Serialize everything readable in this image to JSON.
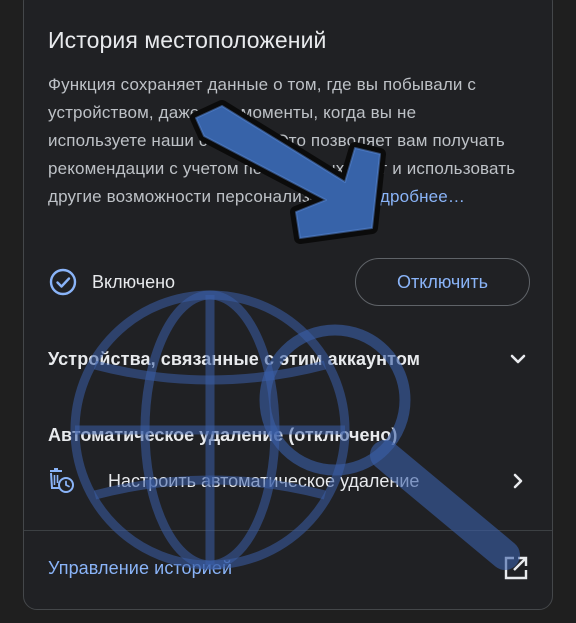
{
  "card": {
    "title": "История местоположений",
    "description": "Функция сохраняет данные о том, где вы побывали с устройством, даже в те моменты, когда вы не используете наши сервисы. Это позволяет вам получать рекомендации с учетом посещенных мест и использовать другие возможности персонализации.",
    "more_link": "Подробнее…"
  },
  "status": {
    "icon": "check-circle-icon",
    "label": "Включено",
    "disable_button": "Отключить"
  },
  "devices": {
    "title": "Устройства, связанные с этим аккаунтом",
    "icon": "chevron-down-icon"
  },
  "auto_delete": {
    "title": "Автоматическое удаление (отключено)",
    "icon": "auto-delete-icon",
    "action_label": "Настроить автоматическое удаление",
    "chevron": "chevron-right-icon"
  },
  "manage": {
    "link": "Управление историей",
    "icon": "open-in-new-icon"
  },
  "colors": {
    "background": "#1f1f1f",
    "card": "#202124",
    "text_primary": "#e8eaed",
    "text_secondary": "#bdc1c6",
    "accent": "#8ab4f8",
    "border": "#5f6368"
  }
}
